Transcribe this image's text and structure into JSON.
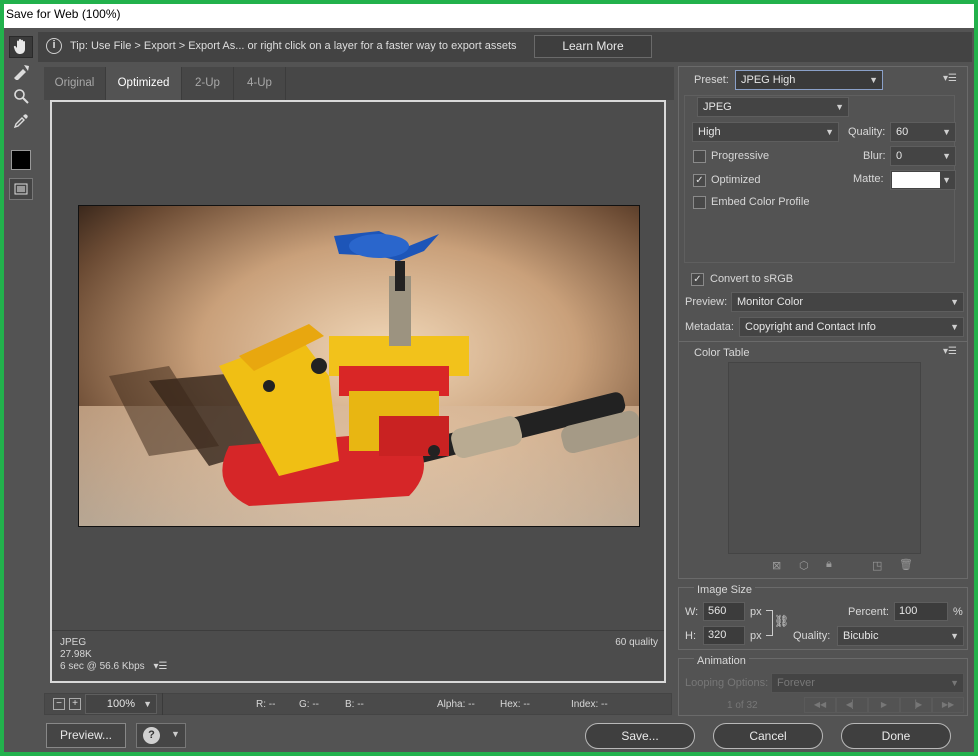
{
  "window": {
    "title": "Save for Web (100%)"
  },
  "tip": {
    "text": "Tip: Use File > Export > Export As...  or right click on a layer for a faster way to export assets",
    "learn_more": "Learn More"
  },
  "tools": [
    "hand-tool",
    "slice-select-tool",
    "zoom-tool",
    "eyedropper-tool"
  ],
  "tabs": [
    "Original",
    "Optimized",
    "2-Up",
    "4-Up"
  ],
  "active_tab": "Optimized",
  "preview_info": {
    "format": "JPEG",
    "size": "27.98K",
    "time": "6 sec @ 56.6 Kbps",
    "quality": "60 quality"
  },
  "statusbar": {
    "zoom": "100%",
    "r": "R: --",
    "g": "G: --",
    "b": "B: --",
    "alpha": "Alpha: --",
    "hex": "Hex: --",
    "index": "Index: --"
  },
  "bottom": {
    "preview": "Preview...",
    "save": "Save...",
    "cancel": "Cancel",
    "done": "Done"
  },
  "settings": {
    "preset_label": "Preset:",
    "preset": "JPEG High",
    "format": "JPEG",
    "quality_level": "High",
    "quality_label": "Quality:",
    "quality": "60",
    "blur_label": "Blur:",
    "blur": "0",
    "matte_label": "Matte:",
    "matte_color": "#ffffff",
    "progressive": "Progressive",
    "optimized": "Optimized",
    "embed": "Embed Color Profile",
    "convert": "Convert to sRGB",
    "preview_label": "Preview:",
    "preview_value": "Monitor Color",
    "metadata_label": "Metadata:",
    "metadata_value": "Copyright and Contact Info"
  },
  "color_table": {
    "title": "Color Table"
  },
  "image_size": {
    "title": "Image Size",
    "w_label": "W:",
    "w": "560",
    "h_label": "H:",
    "h": "320",
    "unit": "px",
    "percent_label": "Percent:",
    "percent": "100",
    "percent_unit": "%",
    "quality_label": "Quality:",
    "quality": "Bicubic"
  },
  "animation": {
    "title": "Animation",
    "looping_label": "Looping Options:",
    "looping": "Forever",
    "frame": "1 of 32"
  },
  "colors": {
    "bg": "#535353",
    "accent_border": "#22b14c"
  }
}
